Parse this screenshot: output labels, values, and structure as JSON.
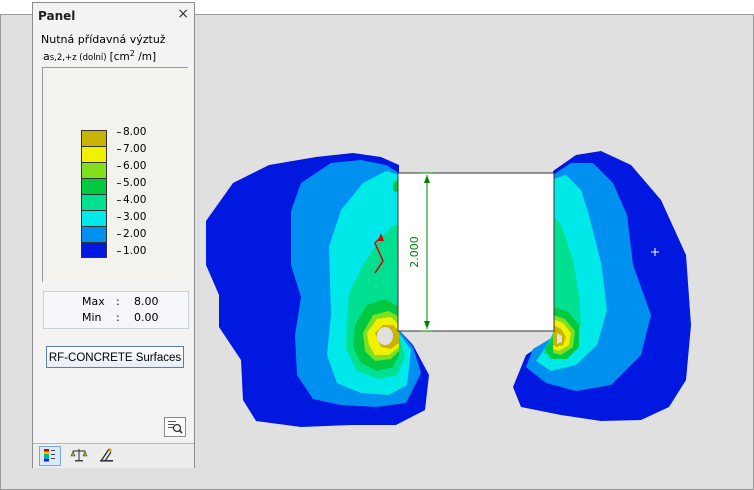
{
  "panel": {
    "title": "Panel",
    "close_symbol": "×",
    "quantity_title": "Nutná přídavná výztuž",
    "quantity_symbol": "a",
    "quantity_subscript": "s,2,+z (dolní)",
    "quantity_unit": "[cm",
    "quantity_unit_exp": "2",
    "quantity_unit_end": " /m]",
    "legend": [
      {
        "label": "8.00",
        "color": "#c8b400"
      },
      {
        "label": "7.00",
        "color": "#f0f000"
      },
      {
        "label": "6.00",
        "color": "#80e020"
      },
      {
        "label": "5.00",
        "color": "#00c840"
      },
      {
        "label": "4.00",
        "color": "#00e090"
      },
      {
        "label": "3.00",
        "color": "#00e8e8"
      },
      {
        "label": "2.00",
        "color": "#0090f0"
      },
      {
        "label": "1.00",
        "color": "#0018e0"
      }
    ],
    "max_label": "Max",
    "max_value": "8.00",
    "min_label": "Min",
    "min_value": "0.00",
    "colon": ":",
    "rf_button": "RF-CONCRETE Surfaces",
    "tabs": [
      "color-scale-tab-icon",
      "balance-tab-icon",
      "view-tab-icon"
    ]
  },
  "model": {
    "dimension_label": "2.000",
    "accent_dimension": "#008000",
    "load_arrow_color": "#e00000"
  }
}
